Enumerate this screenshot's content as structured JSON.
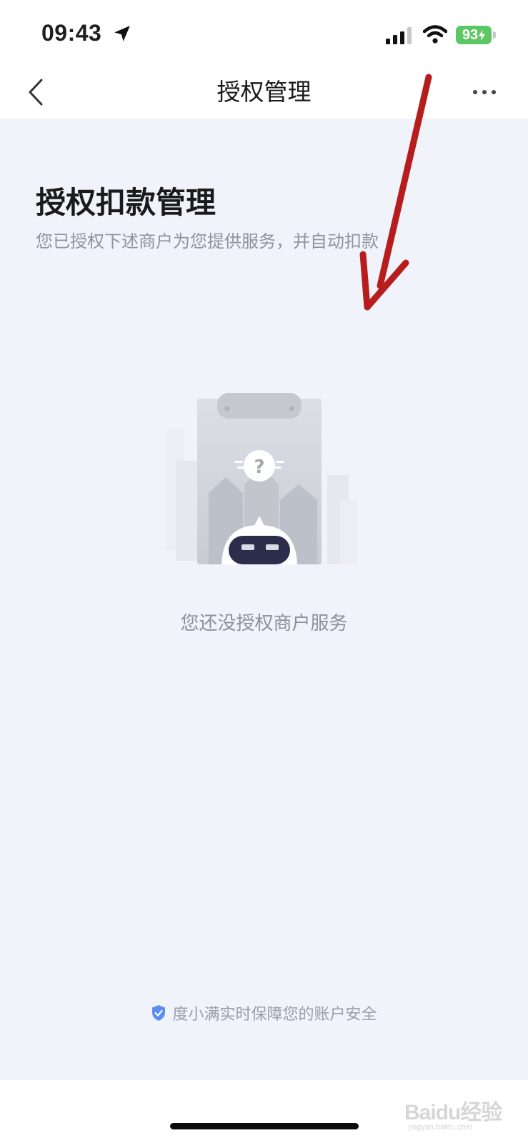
{
  "status_bar": {
    "time": "09:43",
    "battery": "93"
  },
  "nav": {
    "title": "授权管理"
  },
  "content": {
    "title": "授权扣款管理",
    "subtitle": "您已授权下述商户为您提供服务，并自动扣款",
    "empty_text": "您还没授权商户服务"
  },
  "footer": {
    "security_text": "度小满实时保障您的账户安全"
  },
  "watermark": {
    "text": "Baidu经验",
    "sub": "jingyan.baidu.com"
  },
  "colors": {
    "background": "#f1f3fa",
    "battery": "#5cc763",
    "shield": "#5b8ef0",
    "annotation_arrow": "#b81d1d"
  },
  "icons": [
    "location-arrow-icon",
    "signal-icon",
    "wifi-icon",
    "back-chevron-icon",
    "more-icon",
    "shield-check-icon"
  ]
}
